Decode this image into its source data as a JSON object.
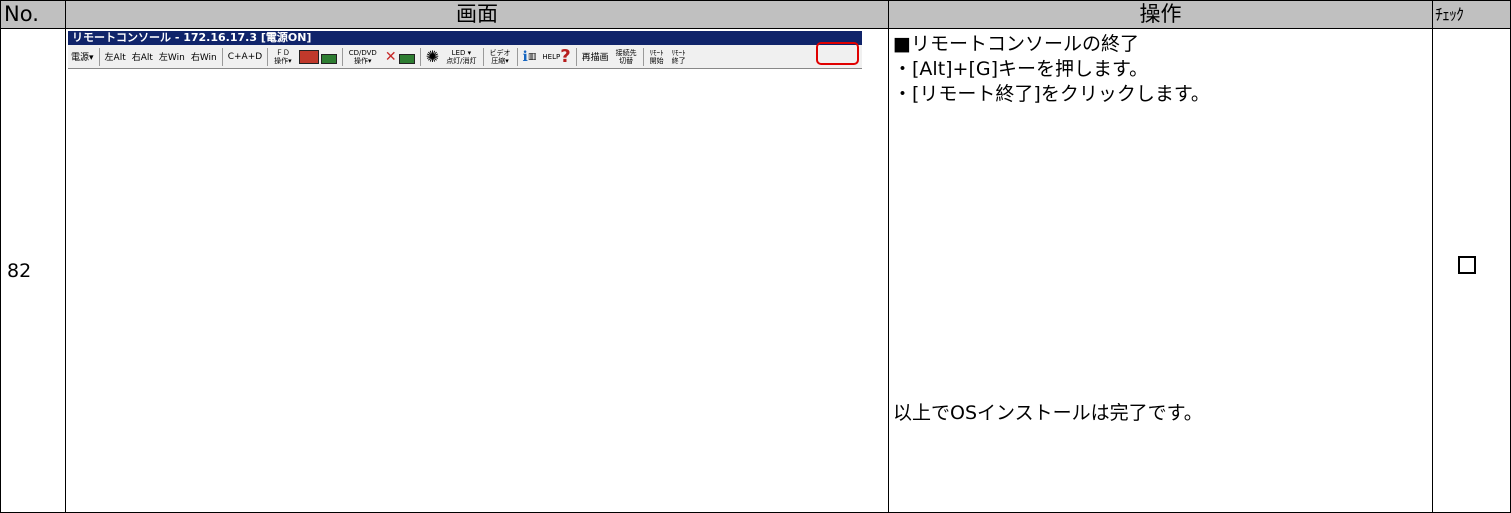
{
  "headers": {
    "no": "No.",
    "screen": "画面",
    "operation": "操作",
    "check": "ﾁｪｯｸ"
  },
  "row": {
    "no": "82",
    "operation_lines": [
      "■リモートコンソールの終了",
      "・[Alt]+[G]キーを押します。",
      "・[リモート終了]をクリックします。"
    ],
    "operation_final": "以上でOSインストールは完了です。",
    "check_symbol": "□"
  },
  "console": {
    "title": "リモートコンソール - 172.16.17.3 [電源ON]",
    "toolbar": {
      "power": "電源▾",
      "left_alt": "左Alt",
      "right_alt": "右Alt",
      "left_win": "左Win",
      "right_win": "右Win",
      "ctrl_alt_del": "C+A+D",
      "fd_top": "ＦＤ",
      "fd_bottom": "操作▾",
      "cd_top": "CD/DVD",
      "cd_bottom": "操作▾",
      "led_top": "LED ▾",
      "led_bottom": "点灯/消灯",
      "video_top": "ビデオ",
      "video_bottom": "圧縮▾",
      "help": "HELP",
      "redraw": "再描画",
      "switch_top": "接続先",
      "switch_bottom": "切替",
      "remote_start_top": "ﾘﾓｰﾄ",
      "remote_start_bottom": "開始",
      "remote_end_top": "ﾘﾓｰﾄ",
      "remote_end_bottom": "終了"
    }
  }
}
